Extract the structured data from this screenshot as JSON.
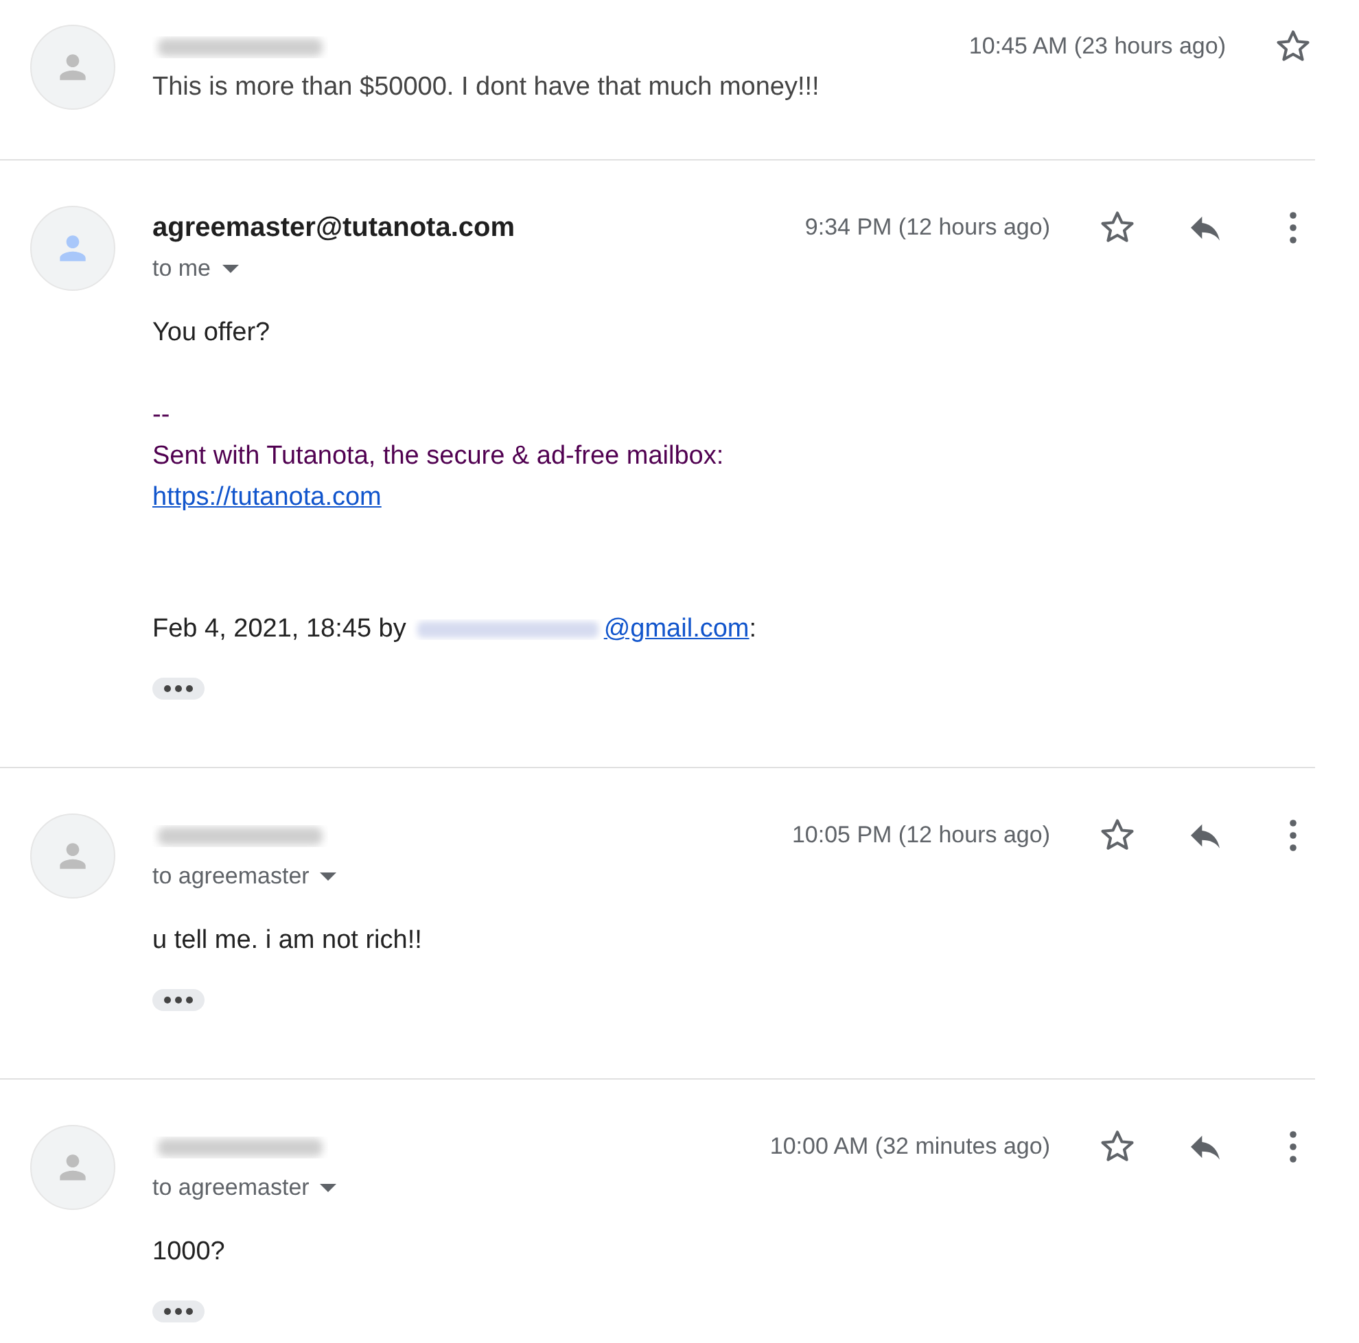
{
  "messages": [
    {
      "kind": "collapsed",
      "sender_hidden": true,
      "color": "#bdbdbd",
      "time": "10:45 AM (23 hours ago)",
      "snippet": "This is more than $50000. I dont have that much money!!!"
    },
    {
      "kind": "expanded",
      "sender_hidden": false,
      "sender": "agreemaster@tutanota.com",
      "color": "#a8c7fa",
      "recipient": "to me",
      "time": "9:34 PM (12 hours ago)",
      "body": [
        {
          "kind": "text",
          "text": "You offer?"
        },
        {
          "kind": "spacer"
        },
        {
          "kind": "signature",
          "text": "--"
        },
        {
          "kind": "signature",
          "text": "Sent with Tutanota, the secure & ad-free mailbox:"
        },
        {
          "kind": "link",
          "text": "https://tutanota.com"
        },
        {
          "kind": "spacer"
        },
        {
          "kind": "spacer"
        },
        {
          "kind": "quote",
          "prefix": "Feb 4, 2021, 18:45 by",
          "link": "@gmail.com",
          "suffix": ":"
        }
      ]
    },
    {
      "kind": "expanded",
      "sender_hidden": true,
      "color": "#bdbdbd",
      "recipient": "to agreemaster",
      "time": "10:05 PM (12 hours ago)",
      "body": [
        {
          "kind": "text",
          "text": "u tell me. i am not rich!!"
        }
      ]
    },
    {
      "kind": "expanded",
      "sender_hidden": true,
      "color": "#bdbdbd",
      "recipient": "to agreemaster",
      "time": "10:00 AM (32 minutes ago)",
      "body": [
        {
          "kind": "text",
          "text": "1000?"
        }
      ]
    }
  ]
}
